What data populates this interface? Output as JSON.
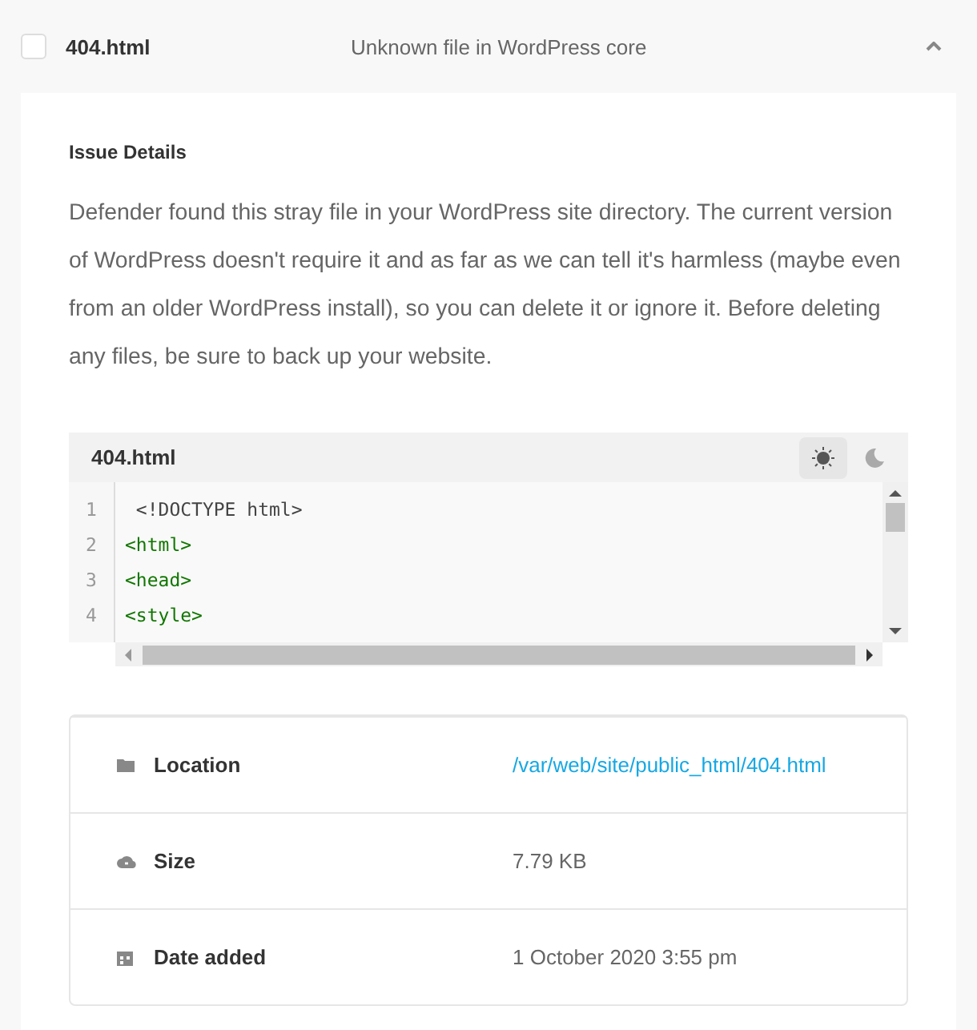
{
  "issue": {
    "checked": false,
    "file_name": "404.html",
    "description": "Unknown file in WordPress core",
    "expanded": true
  },
  "details": {
    "heading": "Issue Details",
    "text": "Defender found this stray file in your WordPress site directory. The current version of WordPress doesn't require it and as far as we can tell it's harmless (maybe even from an older WordPress install), so you can delete it or ignore it. Before deleting any files, be sure to back up your website."
  },
  "code_viewer": {
    "file_name": "404.html",
    "themes": [
      {
        "kind": "light",
        "selected": true
      },
      {
        "kind": "dark",
        "selected": false
      }
    ],
    "lines": [
      {
        "number": "1",
        "kind": "doctype",
        "text": " <!DOCTYPE html>"
      },
      {
        "number": "2",
        "kind": "tag",
        "text": "<html>"
      },
      {
        "number": "3",
        "kind": "tag",
        "text": "<head>"
      },
      {
        "number": "4",
        "kind": "tag",
        "text": "<style>"
      }
    ]
  },
  "info_rows": [
    {
      "kind": "location",
      "label": "Location",
      "value": "/var/web/site/public_html/404.html",
      "link": true
    },
    {
      "kind": "size",
      "label": "Size",
      "value": "7.79 KB",
      "link": false
    },
    {
      "kind": "date",
      "label": "Date added",
      "value": "1 October 2020 3:55 pm",
      "link": false
    }
  ]
}
